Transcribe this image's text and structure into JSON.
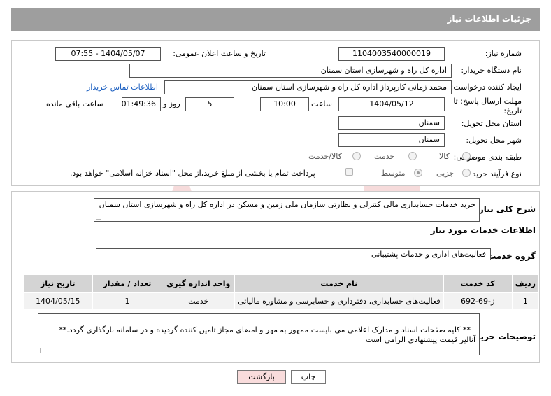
{
  "header": {
    "title": "جزئیات اطلاعات نیاز"
  },
  "form": {
    "need_number": {
      "label": "شماره نیاز:",
      "value": "1104003540000019"
    },
    "announce_datetime": {
      "label": "تاریخ و ساعت اعلان عمومی:",
      "value": "1404/05/07 - 07:55"
    },
    "buyer_org": {
      "label": "نام دستگاه خریدار:",
      "value": "اداره کل راه و شهرسازی استان سمنان"
    },
    "requester": {
      "label": "ایجاد کننده درخواست:",
      "value": "محمد زمانی کارپرداز اداره کل راه و شهرسازی استان سمنان",
      "contact_link": "اطلاعات تماس خریدار"
    },
    "deadline": {
      "label_line1": "مهلت ارسال پاسخ: تا",
      "label_line2": "تاریخ:",
      "date": "1404/05/12",
      "time_label": "ساعت",
      "time": "10:00",
      "days": "5",
      "days_label": "روز و",
      "remaining": "01:49:36",
      "remaining_label": "ساعت باقی مانده"
    },
    "delivery_province": {
      "label": "استان محل تحویل:",
      "value": "سمنان"
    },
    "delivery_city": {
      "label": "شهر محل تحویل:",
      "value": "سمنان"
    },
    "category": {
      "label": "طبقه بندی موضوعی:",
      "options": [
        "کالا",
        "خدمت",
        "کالا/خدمت"
      ]
    },
    "purchase_type": {
      "label": "نوع فرآیند خرید :",
      "options": [
        "جزیی",
        "متوسط"
      ],
      "checkbox_text": "پرداخت تمام یا بخشی از مبلغ خرید،از محل \"اسناد خزانه اسلامی\" خواهد بود."
    }
  },
  "summary": {
    "label": "شرح کلی نیاز:",
    "text": "خرید خدمات حسابداری مالی کنترلی و نظارتی سازمان ملی زمین و مسکن در اداره کل راه و شهرسازی استان سمنان"
  },
  "services": {
    "title": "اطلاعات خدمات مورد نیاز",
    "group_label": "گروه خدمت:",
    "group_value": "فعالیت‌های اداری و خدمات پشتیبانی",
    "columns": [
      "ردیف",
      "کد خدمت",
      "نام خدمت",
      "واحد اندازه گیری",
      "تعداد / مقدار",
      "تاریخ نیاز"
    ],
    "rows": [
      [
        "1",
        "ز-69-692",
        "فعالیت‌های حسابداری، دفترداری و حسابرسی و مشاوره مالیاتی",
        "خدمت",
        "1",
        "1404/05/15"
      ]
    ]
  },
  "buyer_notes": {
    "label": "توضیحات خریدار:",
    "text": "** کلیه صفحات اسناد و مدارک اعلامی می بایست ممهور به مهر و امضای مجاز تامین کننده گردیده و در سامانه بارگذاری گردد.**\nآنالیز قیمت پیشنهادی الزامی است"
  },
  "buttons": {
    "print": "چاپ",
    "back": "بازگشت"
  },
  "colors": {
    "header": "#9e9e9e",
    "link": "#1a5ec0",
    "back_button": "#f9dcdc",
    "watermark": "#f2c9c9"
  }
}
